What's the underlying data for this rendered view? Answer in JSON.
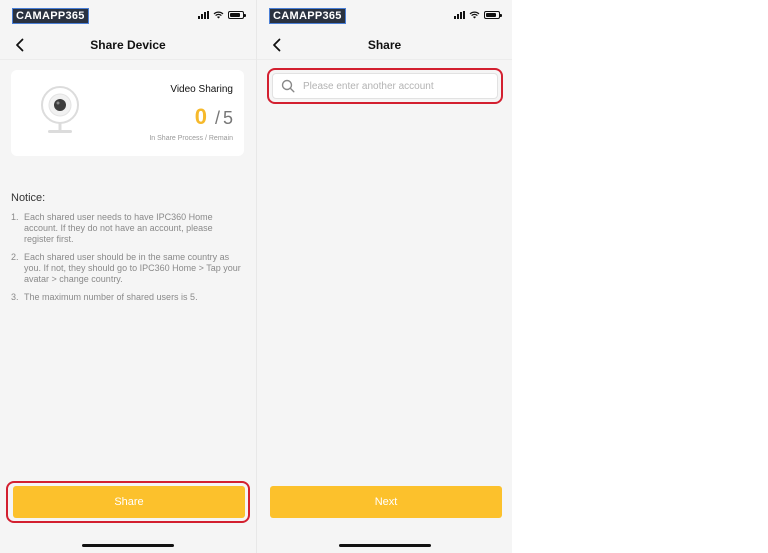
{
  "watermark": "CAMAPP365",
  "colors": {
    "accent": "#fcc12c",
    "count_accent": "#f6b92b",
    "highlight": "#d32030"
  },
  "left_screen": {
    "title": "Share Device",
    "card": {
      "title": "Video Sharing",
      "current": "0",
      "separator": "/",
      "total": "5",
      "caption": "In Share Process / Remain"
    },
    "notice": {
      "title": "Notice:",
      "items": [
        {
          "num": "1.",
          "text": "Each shared user needs to have IPC360 Home account. If they do not have an account, please register first."
        },
        {
          "num": "2.",
          "text": "Each shared user should be in the same country as you. If not, they should go to IPC360 Home > Tap your avatar > change country."
        },
        {
          "num": "3.",
          "text": "The maximum number of shared users is 5."
        }
      ]
    },
    "button_label": "Share"
  },
  "right_screen": {
    "title": "Share",
    "search": {
      "placeholder": "Please enter another account",
      "value": ""
    },
    "button_label": "Next"
  }
}
